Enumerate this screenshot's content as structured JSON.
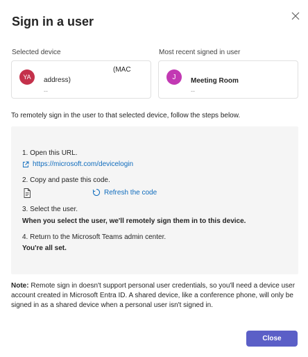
{
  "dialog": {
    "title": "Sign in a user",
    "close_icon": "close-icon"
  },
  "selected_device": {
    "label": "Selected device",
    "avatar_initials": "YA",
    "avatar_color": "#c4314b",
    "mac_text": "(MAC",
    "address_text": "address)",
    "sub_text": "--"
  },
  "recent_user": {
    "label": "Most recent signed in user",
    "avatar_initials": "J",
    "avatar_color": "#c239b3",
    "name": "Meeting Room",
    "sub_text": "--"
  },
  "instructions": "To remotely sign in the user to that selected device, follow the steps below.",
  "steps": {
    "step1_text": "1. Open this URL.",
    "step1_link": "https://microsoft.com/devicelogin",
    "step2_text": "2. Copy and paste this code.",
    "step2_refresh": "Refresh the code",
    "step3_text": "3. Select the user.",
    "step3_bold": "When you select the user, we'll remotely sign them in to this device.",
    "step4_text": "4. Return to the Microsoft Teams admin center.",
    "step4_bold": "You're all set."
  },
  "note": {
    "label": "Note:",
    "text": "Remote sign in doesn't support personal user credentials, so you'll need a device user account created in Microsoft Entra ID. A shared device, like a conference phone, will only be signed in as a shared device when a personal user isn't signed in."
  },
  "footer": {
    "close_label": "Close"
  },
  "colors": {
    "accent": "#5b5fc7",
    "link": "#0f6cbd",
    "steps_background": "#f5f5f5"
  }
}
